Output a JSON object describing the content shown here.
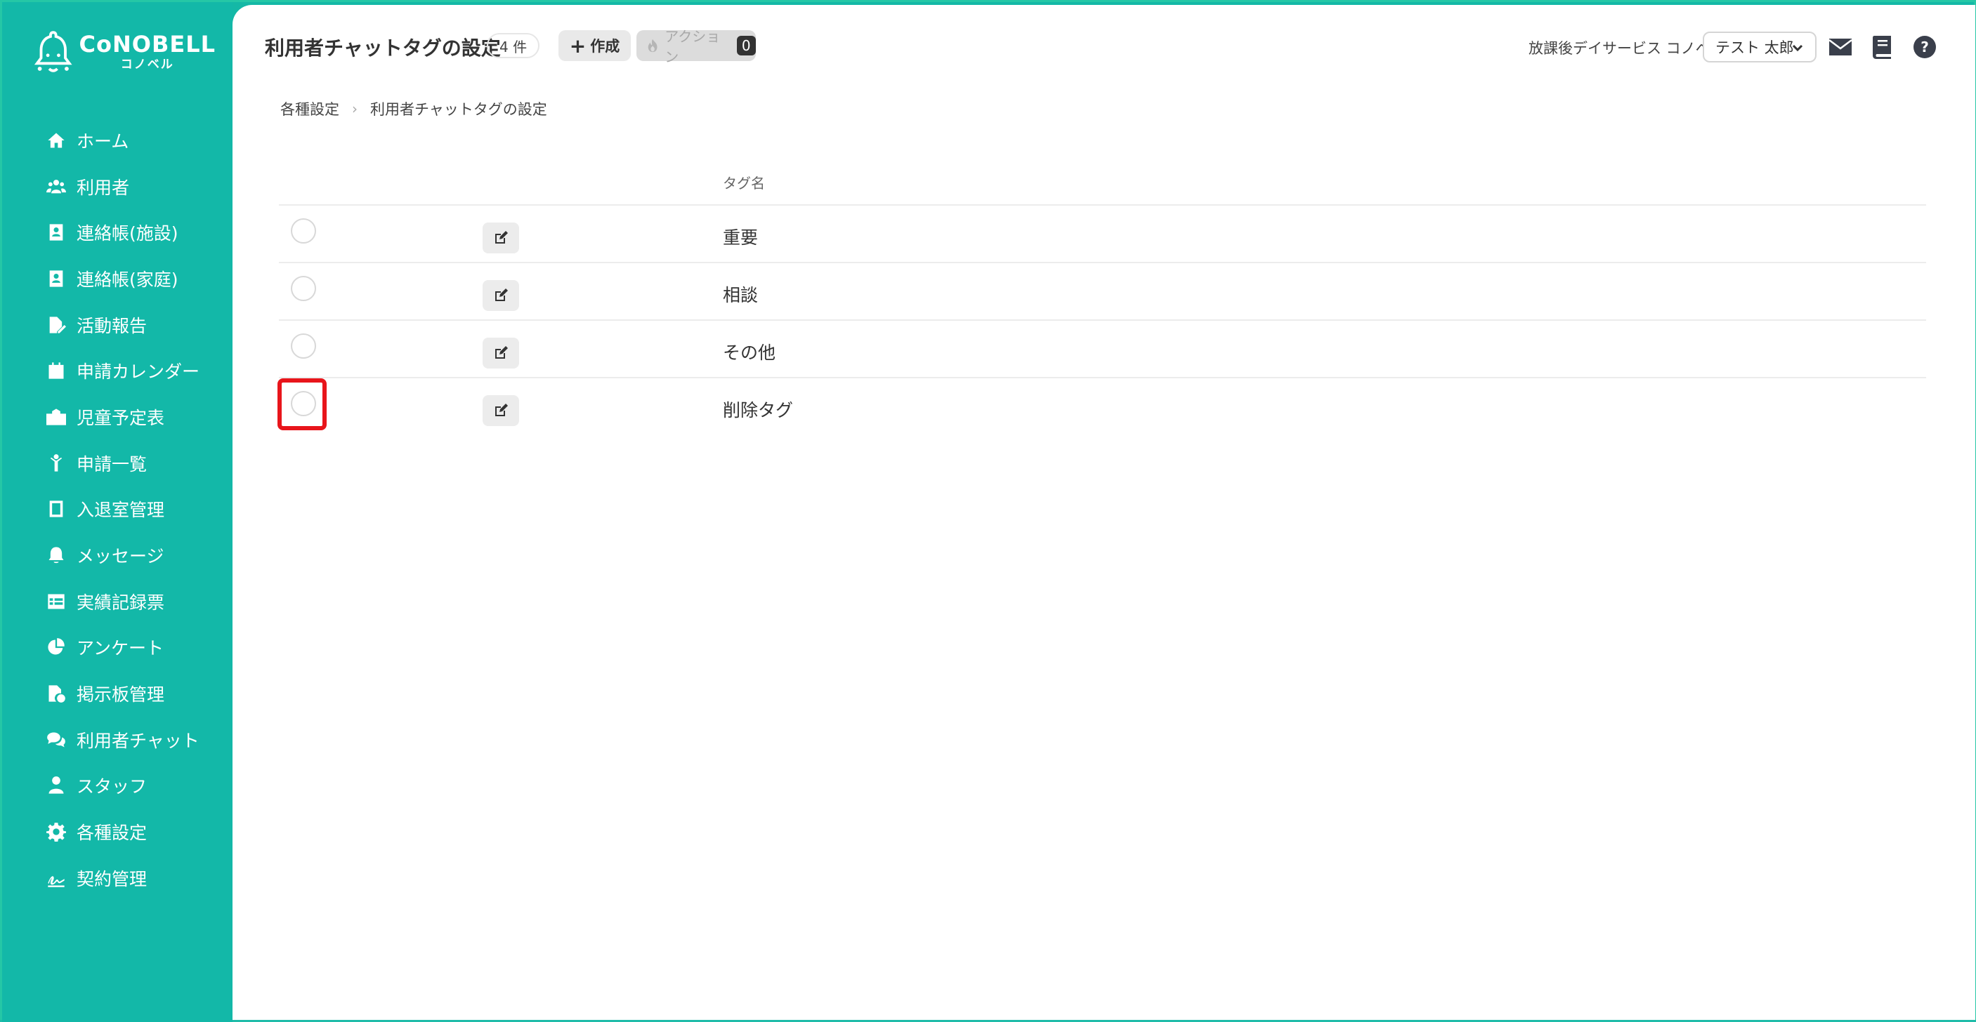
{
  "brand": {
    "logo_main": "CoNOBELL",
    "logo_sub": "コノベル"
  },
  "sidebar": {
    "items": [
      {
        "label": "ホーム",
        "icon": "home-icon"
      },
      {
        "label": "利用者",
        "icon": "users-icon"
      },
      {
        "label": "連絡帳(施設)",
        "icon": "address-book-icon"
      },
      {
        "label": "連絡帳(家庭)",
        "icon": "address-book-icon"
      },
      {
        "label": "活動報告",
        "icon": "file-edit-icon"
      },
      {
        "label": "申請カレンダー",
        "icon": "calendar-icon"
      },
      {
        "label": "児童予定表",
        "icon": "school-icon"
      },
      {
        "label": "申請一覧",
        "icon": "child-icon"
      },
      {
        "label": "入退室管理",
        "icon": "tablet-icon"
      },
      {
        "label": "メッセージ",
        "icon": "bell-icon"
      },
      {
        "label": "実績記録票",
        "icon": "table-icon"
      },
      {
        "label": "アンケート",
        "icon": "pie-chart-icon"
      },
      {
        "label": "掲示板管理",
        "icon": "file-check-icon"
      },
      {
        "label": "利用者チャット",
        "icon": "comments-icon"
      },
      {
        "label": "スタッフ",
        "icon": "staff-icon"
      },
      {
        "label": "各種設定",
        "icon": "gear-icon"
      },
      {
        "label": "契約管理",
        "icon": "signature-icon"
      }
    ]
  },
  "header": {
    "title": "利用者チャットタグの設定",
    "count": "4 件",
    "create_label": "作成",
    "action_label": "アクション",
    "action_count": "0",
    "facility": "放課後デイサービス コノベル",
    "user": "テスト 太郎"
  },
  "breadcrumb": {
    "parent": "各種設定",
    "current": "利用者チャットタグの設定"
  },
  "table": {
    "column_name": "タグ名",
    "rows": [
      {
        "name": "重要"
      },
      {
        "name": "相談"
      },
      {
        "name": "その他"
      },
      {
        "name": "削除タグ"
      }
    ]
  },
  "colors": {
    "brand": "#13b8a8",
    "highlight": "#e8151b"
  }
}
